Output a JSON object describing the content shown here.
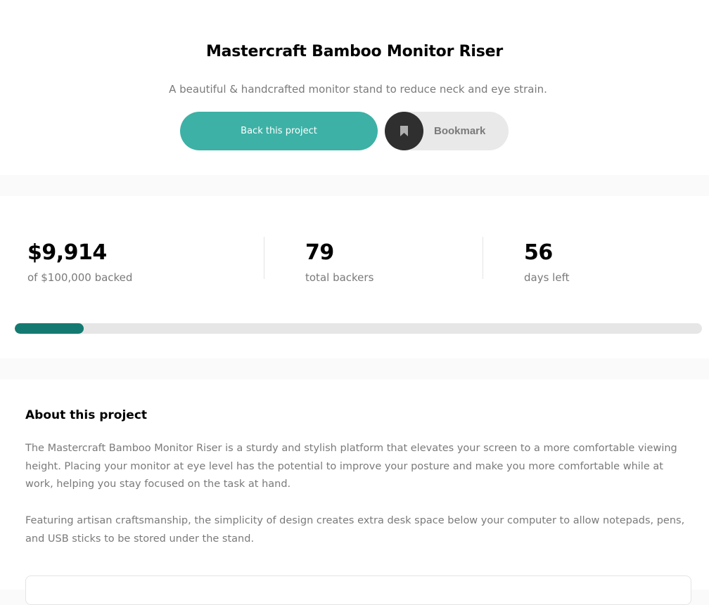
{
  "project": {
    "title": "Mastercraft Bamboo Monitor Riser",
    "description": "A beautiful & handcrafted monitor stand to reduce neck and eye strain.",
    "back_label": "Back this project",
    "bookmark_label": "Bookmark",
    "bookmark_icon": "bookmark-icon"
  },
  "stats": {
    "backed_amount": "$9,914",
    "backed_label": "of $100,000 backed",
    "backers_count": "79",
    "backers_label": "total backers",
    "days_left": "56",
    "days_label": "days left",
    "progress_fraction": 0.1,
    "colors": {
      "accent": "#3db1a6",
      "progress": "#147a71"
    }
  },
  "about": {
    "title": "About this project",
    "paragraph_1": "The Mastercraft Bamboo Monitor Riser is a sturdy and stylish platform that elevates your screen to a more comfortable viewing height. Placing your monitor at eye level has the potential to improve your posture and make you more comfortable while at work, helping you stay focused on the task at hand.",
    "paragraph_2": "Featuring artisan craftsmanship, the simplicity of design creates extra desk space below your computer to allow notepads, pens, and USB sticks to be stored under the stand."
  }
}
